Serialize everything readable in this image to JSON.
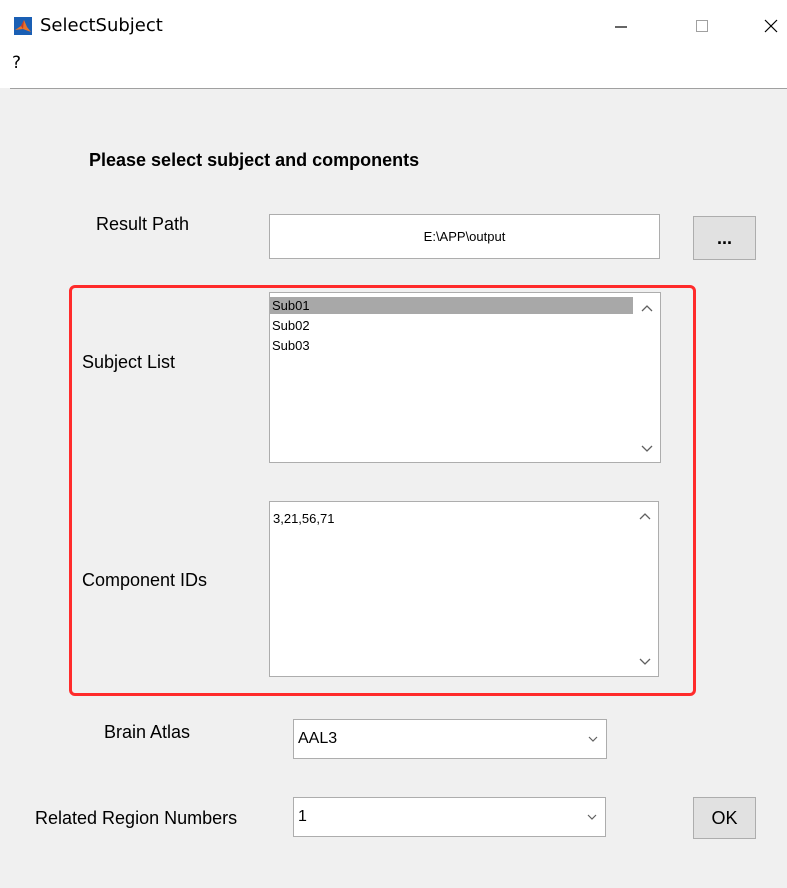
{
  "window": {
    "title": "SelectSubject",
    "accent_color": "#ff2b2b"
  },
  "menu": {
    "help_label": "?"
  },
  "form": {
    "heading": "Please select subject and components",
    "result_path_label": "Result Path",
    "result_path_value": "E:\\APP\\output",
    "browse_label": "...",
    "subject_list_label": "Subject List",
    "subjects": [
      "Sub01",
      "Sub02",
      "Sub03"
    ],
    "selected_subject": "Sub01",
    "component_ids_label": "Component IDs",
    "component_ids_value": "3,21,56,71",
    "brain_atlas_label": "Brain Atlas",
    "brain_atlas_value": "AAL3",
    "related_region_label": "Related Region Numbers",
    "related_region_value": "1",
    "ok_label": "OK"
  }
}
